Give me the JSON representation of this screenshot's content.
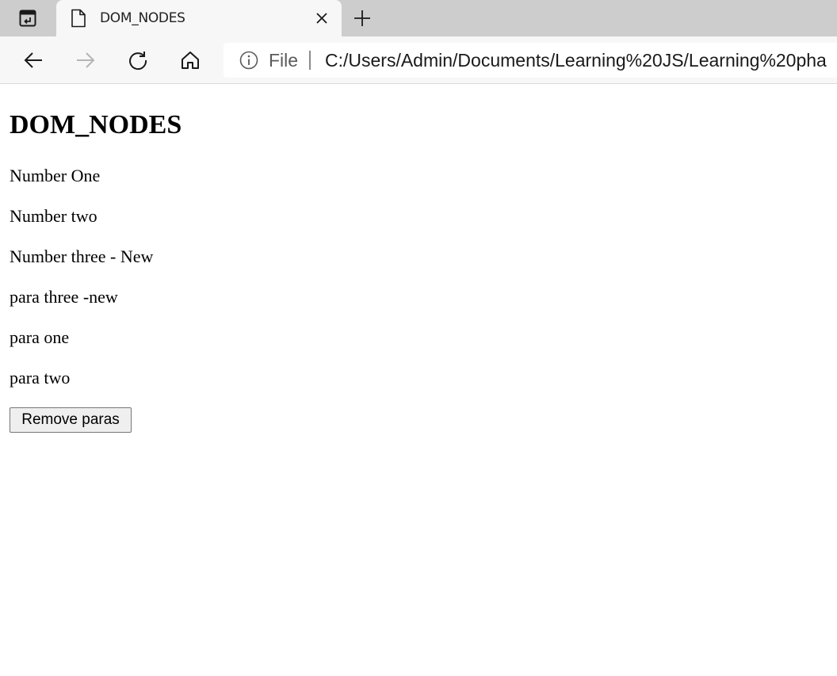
{
  "browser": {
    "tab": {
      "title": "DOM_NODES"
    },
    "address_bar": {
      "scheme_label": "File",
      "url": "C:/Users/Admin/Documents/Learning%20JS/Learning%20pha"
    },
    "icons": {
      "tab_actions": "tab-actions-icon",
      "favicon": "page-icon",
      "close": "close-icon",
      "new_tab": "plus-icon",
      "back": "back-arrow-icon",
      "forward": "forward-arrow-icon",
      "refresh": "refresh-icon",
      "home": "home-icon",
      "info": "info-icon"
    }
  },
  "page": {
    "heading": "DOM_NODES",
    "paragraphs": [
      "Number One",
      "Number two",
      "Number three - New",
      "para three -new",
      "para one",
      "para two"
    ],
    "button_label": "Remove paras"
  }
}
